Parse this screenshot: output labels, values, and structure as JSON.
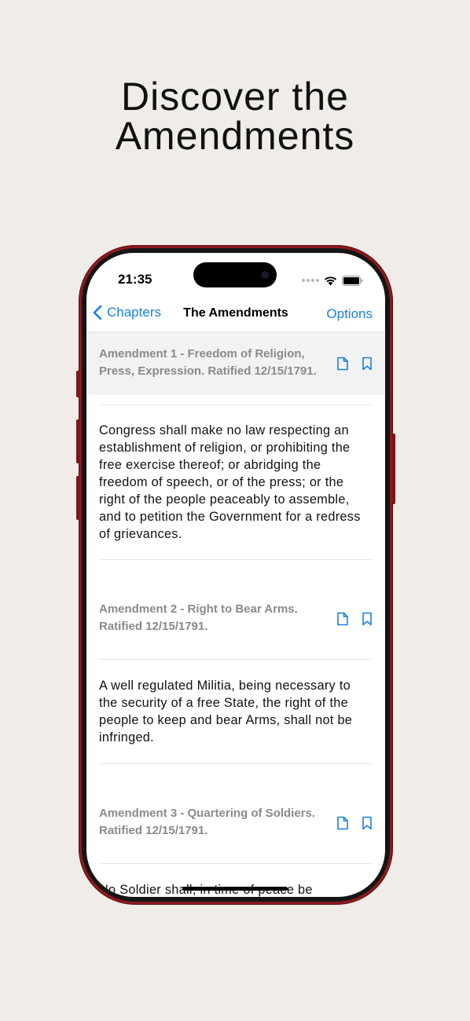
{
  "headline": {
    "line1": "Discover the",
    "line2": "Amendments"
  },
  "status_bar": {
    "time": "21:35"
  },
  "nav": {
    "back_label": "Chapters",
    "title": "The Amendments",
    "options_label": "Options"
  },
  "amendments": [
    {
      "header": "Amendment 1 - Freedom of Religion, Press, Expression. Ratified 12/15/1791.",
      "text": "Congress shall make no law respecting an establishment of religion, or prohibiting the free exercise thereof; or abridging the freedom of speech, or of the press; or the right of the people peaceably to assemble, and to petition the Government for a redress of grievances."
    },
    {
      "header": "Amendment 2 - Right to Bear Arms. Ratified 12/15/1791.",
      "text": "A well regulated Militia, being necessary to the security of a free State, the right of the people to keep and bear Arms, shall not be infringed."
    },
    {
      "header": "Amendment 3 - Quartering of Soldiers. Ratified 12/15/1791.",
      "text": "No Soldier shall, in time of peace be"
    }
  ],
  "colors": {
    "accent": "#1a7fe0",
    "phone_frame": "#8e1a1f",
    "page_background": "#f0ece7"
  }
}
